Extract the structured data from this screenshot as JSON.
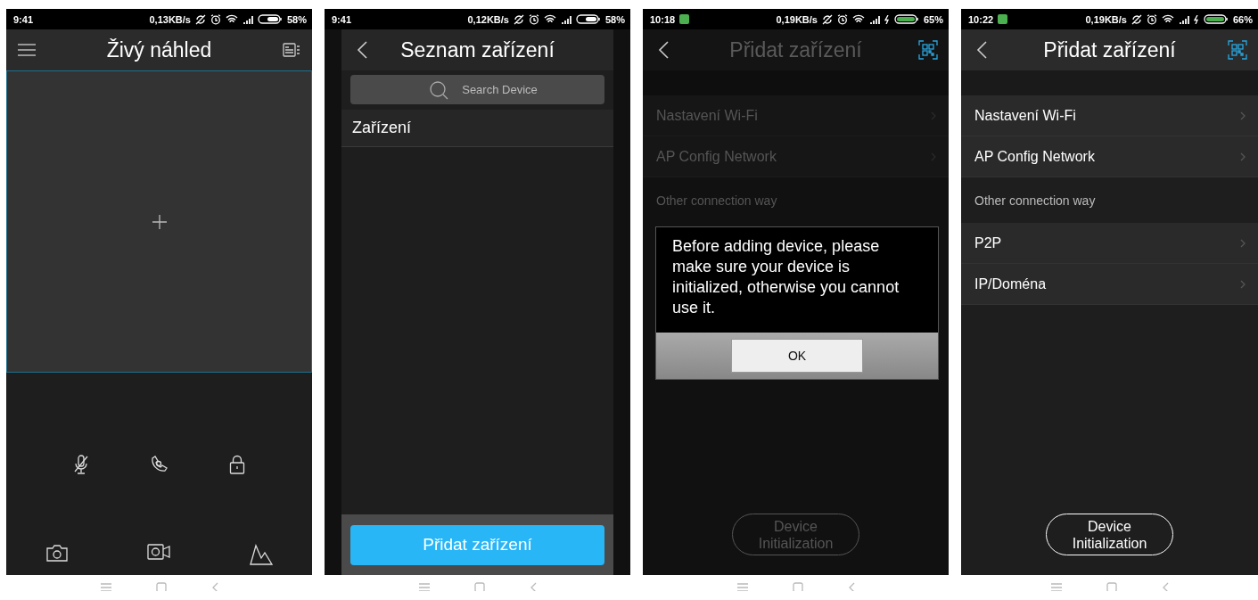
{
  "screens": [
    {
      "kind": "live_view",
      "dimmed": false,
      "status_bar": {
        "time": "9:41",
        "notification": false,
        "speed": "0,13KB/s",
        "charging": false,
        "battery": "58%"
      },
      "header": {
        "title": "Živý náhled"
      }
    },
    {
      "kind": "device_list",
      "dimmed": false,
      "status_bar": {
        "time": "9:41",
        "notification": false,
        "speed": "0,12KB/s",
        "charging": false,
        "battery": "58%"
      },
      "header": {
        "title": "Seznam zařízení"
      },
      "search": {
        "placeholder": "Search Device"
      },
      "section": "Zařízení",
      "add_button": "Přidat zařízení"
    },
    {
      "kind": "add_device",
      "dimmed": true,
      "status_bar": {
        "time": "10:18",
        "notification": true,
        "speed": "0,19KB/s",
        "charging": true,
        "battery": "65%"
      },
      "header": {
        "title": "Přidat zařízení"
      },
      "items": [
        {
          "kind": "row",
          "label": "Nastavení Wi-Fi"
        },
        {
          "kind": "row",
          "label": "AP Config Network"
        },
        {
          "kind": "section",
          "label": "Other connection way"
        }
      ],
      "init_button": "Device Initialization",
      "dialog": {
        "message": "Before adding device, please make sure your device is initialized, otherwise you cannot use it.",
        "button": "OK"
      }
    },
    {
      "kind": "add_device",
      "dimmed": false,
      "status_bar": {
        "time": "10:22",
        "notification": true,
        "speed": "0,19KB/s",
        "charging": true,
        "battery": "66%"
      },
      "header": {
        "title": "Přidat zařízení"
      },
      "items": [
        {
          "kind": "row",
          "label": "Nastavení Wi-Fi"
        },
        {
          "kind": "row",
          "label": "AP Config Network"
        },
        {
          "kind": "section",
          "label": "Other connection way"
        },
        {
          "kind": "row",
          "label": "P2P"
        },
        {
          "kind": "row",
          "label": "IP/Doména"
        }
      ],
      "init_button": "Device Initialization"
    }
  ]
}
